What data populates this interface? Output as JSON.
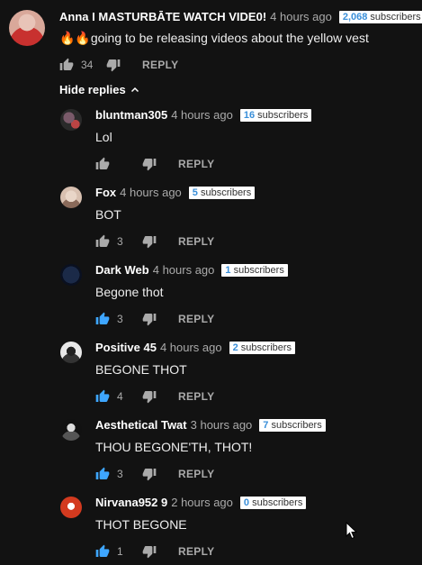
{
  "top_comment": {
    "author": "Anna I MASTURBĀTE WATCH VIDE0!",
    "time": "4 hours ago",
    "subscribers_count": "2,068",
    "subscribers_label": "subscribers",
    "text": "🔥🔥going to be releasing videos about the yellow vest",
    "likes": "34",
    "reply_label": "REPLY"
  },
  "hide_replies_label": "Hide replies",
  "replies": [
    {
      "author": "bluntman305",
      "time": "4 hours ago",
      "subscribers_count": "16",
      "subscribers_label": "subscribers",
      "text": "Lol",
      "likes": "",
      "liked": false,
      "reply_label": "REPLY"
    },
    {
      "author": "Fox",
      "time": "4 hours ago",
      "subscribers_count": "5",
      "subscribers_label": "subscribers",
      "text": "BOT",
      "likes": "3",
      "liked": false,
      "reply_label": "REPLY"
    },
    {
      "author": "Dark Web",
      "time": "4 hours ago",
      "subscribers_count": "1",
      "subscribers_label": "subscribers",
      "text": "Begone thot",
      "likes": "3",
      "liked": true,
      "reply_label": "REPLY"
    },
    {
      "author": "Positive 45",
      "time": "4 hours ago",
      "subscribers_count": "2",
      "subscribers_label": "subscribers",
      "text": "BEGONE THOT",
      "likes": "4",
      "liked": true,
      "reply_label": "REPLY"
    },
    {
      "author": "Aesthetical Twat",
      "time": "3 hours ago",
      "subscribers_count": "7",
      "subscribers_label": "subscribers",
      "text": "THOU BEGONE'TH, THOT!",
      "likes": "3",
      "liked": true,
      "reply_label": "REPLY"
    },
    {
      "author": "Nirvana952 9",
      "time": "2 hours ago",
      "subscribers_count": "0",
      "subscribers_label": "subscribers",
      "text": "THOT BEGONE",
      "likes": "1",
      "liked": true,
      "reply_label": "REPLY"
    }
  ],
  "colors": {
    "background": "#121212",
    "liked_accent": "#3ea6ff",
    "muted": "#aaaaaa",
    "badge_number": "#3a8fd9"
  },
  "icons": {
    "like": "thumbs-up-icon",
    "dislike": "thumbs-down-icon",
    "hide": "chevron-up-icon",
    "cursor": "mouse-pointer-icon"
  }
}
